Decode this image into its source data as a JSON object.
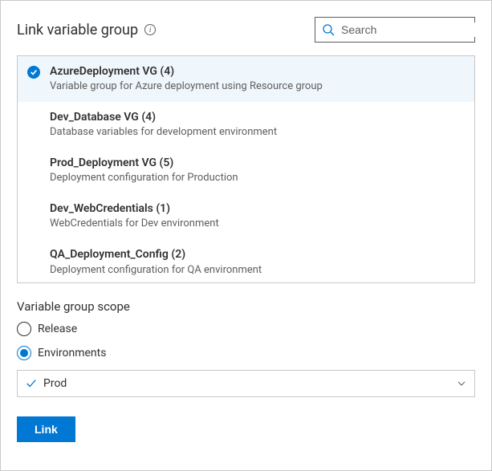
{
  "header": {
    "title": "Link variable group",
    "search_placeholder": "Search"
  },
  "variable_groups": [
    {
      "name": "AzureDeployment VG (4)",
      "desc": "Variable group for Azure deployment using Resource group",
      "selected": true
    },
    {
      "name": "Dev_Database VG (4)",
      "desc": "Database variables for development environment",
      "selected": false
    },
    {
      "name": "Prod_Deployment VG (5)",
      "desc": "Deployment configuration for Production",
      "selected": false
    },
    {
      "name": "Dev_WebCredentials (1)",
      "desc": "WebCredentials for Dev environment",
      "selected": false
    },
    {
      "name": "QA_Deployment_Config (2)",
      "desc": "Deployment configuration for QA environment",
      "selected": false
    }
  ],
  "scope": {
    "section_label": "Variable group scope",
    "options": {
      "release": "Release",
      "environments": "Environments"
    },
    "selected": "environments",
    "environment_value": "Prod"
  },
  "buttons": {
    "link": "Link"
  }
}
